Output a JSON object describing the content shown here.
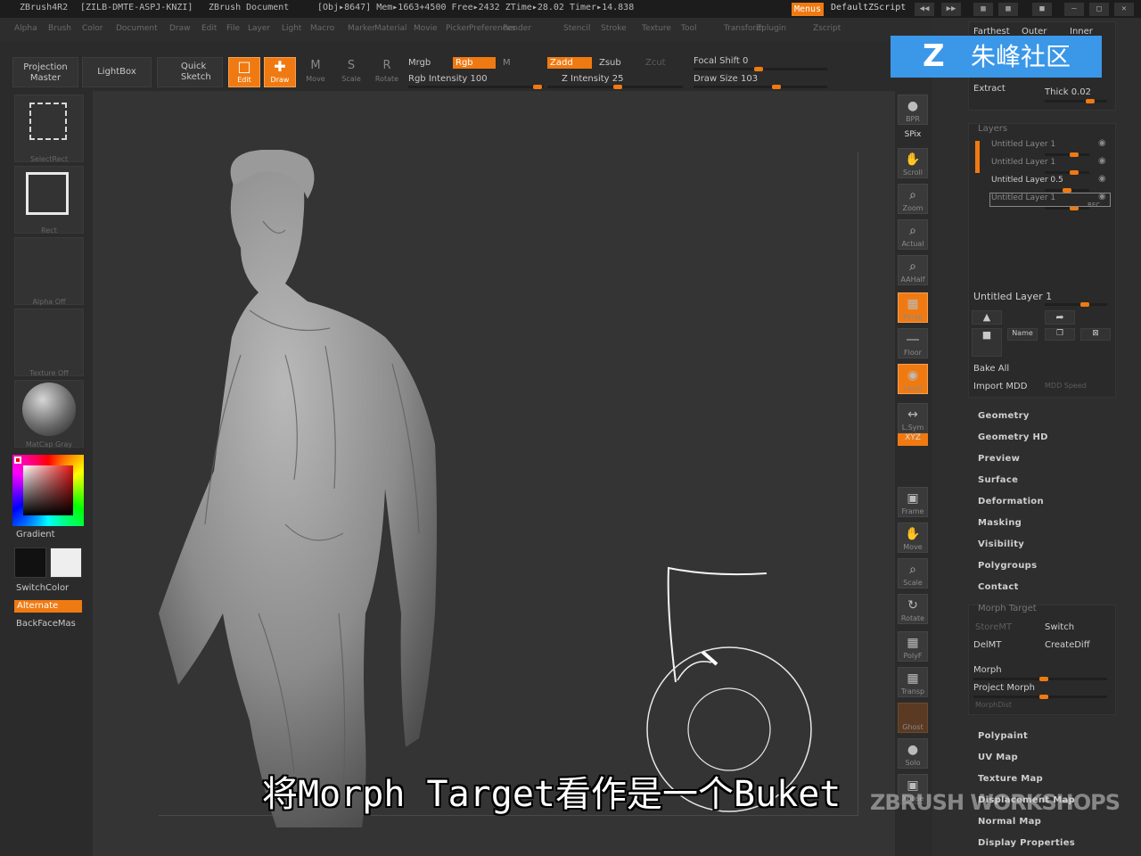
{
  "title_bar": {
    "app": "ZBrush4R2",
    "license": "[ZILB-DMTE-ASPJ-KNZI]",
    "doc": "ZBrush Document",
    "stats": "[Obj▸8647] Mem▸1663+4500 Free▸2432 ZTime▸28.02 Timer▸14.838",
    "menus_btn": "Menus",
    "script": "DefaultZScript"
  },
  "menu": [
    "Alpha",
    "Brush",
    "Color",
    "Document",
    "Draw",
    "Edit",
    "File",
    "Layer",
    "Light",
    "Macro",
    "Marker",
    "Material",
    "Movie",
    "Picker",
    "Preferences",
    "Render",
    "Stencil",
    "Stroke",
    "Texture",
    "Tool",
    "Transform",
    "Zplugin",
    "Zscript"
  ],
  "top_shelf": {
    "projection_master": "Projection Master",
    "lightbox": "LightBox",
    "quick_sketch": "Quick Sketch",
    "edit": "Edit",
    "draw": "Draw",
    "move": "Move",
    "scale": "Scale",
    "rotate": "Rotate",
    "mrgb": "Mrgb",
    "rgb": "Rgb",
    "m": "M",
    "rgb_intensity": "Rgb Intensity 100",
    "zadd": "Zadd",
    "zsub": "Zsub",
    "zcut": "Zcut",
    "z_intensity": "Z Intensity 25",
    "focal_shift": "Focal Shift 0",
    "draw_size": "Draw Size 103"
  },
  "left_panel": {
    "select_rect": "SelectRect",
    "rect": "Rect",
    "alpha_off": "Alpha Off",
    "texture_off": "Texture Off",
    "matcap": "MatCap Gray",
    "gradient": "Gradient",
    "switch_color": "SwitchColor",
    "alternate": "Alternate",
    "backface": "BackFaceMas"
  },
  "right_shelf": [
    "BPR",
    "SPix",
    "Scroll",
    "Zoom",
    "Actual",
    "AAHalf",
    "Persp",
    "Floor",
    "Local",
    "L.Sym",
    "XYZ",
    "Frame",
    "Move",
    "Scale",
    "Rotate",
    "PolyF",
    "Transp",
    "Ghost",
    "Solo",
    "Xpose"
  ],
  "right_panel": {
    "farthest": "Farthest",
    "outer": "Outer",
    "inner": "Inner",
    "extract": "Extract",
    "thick": "Thick 0.02",
    "layers_title": "Layers",
    "layers": [
      "Untitled Layer 1",
      "Untitled Layer 1",
      "Untitled Layer 0.5",
      "Untitled Layer 1"
    ],
    "rec": "REC",
    "selected_layer": "Untitled Layer 1",
    "name_btn": "Name",
    "bake_all": "Bake All",
    "import_mdd": "Import MDD",
    "mdd_speed": "MDD Speed",
    "menu_items": [
      "Geometry",
      "Geometry HD",
      "Preview",
      "Surface",
      "Deformation",
      "Masking",
      "Visibility",
      "Polygroups",
      "Contact"
    ],
    "morph_target": "Morph Target",
    "store_mt": "StoreMT",
    "switch": "Switch",
    "del_mt": "DelMT",
    "create_diff": "CreateDiff",
    "morph": "Morph",
    "project_morph": "Project Morph",
    "morph_dist": "MorphDist",
    "menu_items_2": [
      "Polypaint",
      "UV Map",
      "Texture Map",
      "Displacement Map",
      "Normal Map",
      "Display Properties"
    ]
  },
  "overlay": {
    "logo": "朱峰社区",
    "subtitle": "将Morph Target看作是一个Buket",
    "watermark": "ZBRUSH WORKSHOPS"
  },
  "colors": {
    "accent": "#f07a12",
    "panel": "#2e2e2e",
    "canvas": "#343434"
  }
}
